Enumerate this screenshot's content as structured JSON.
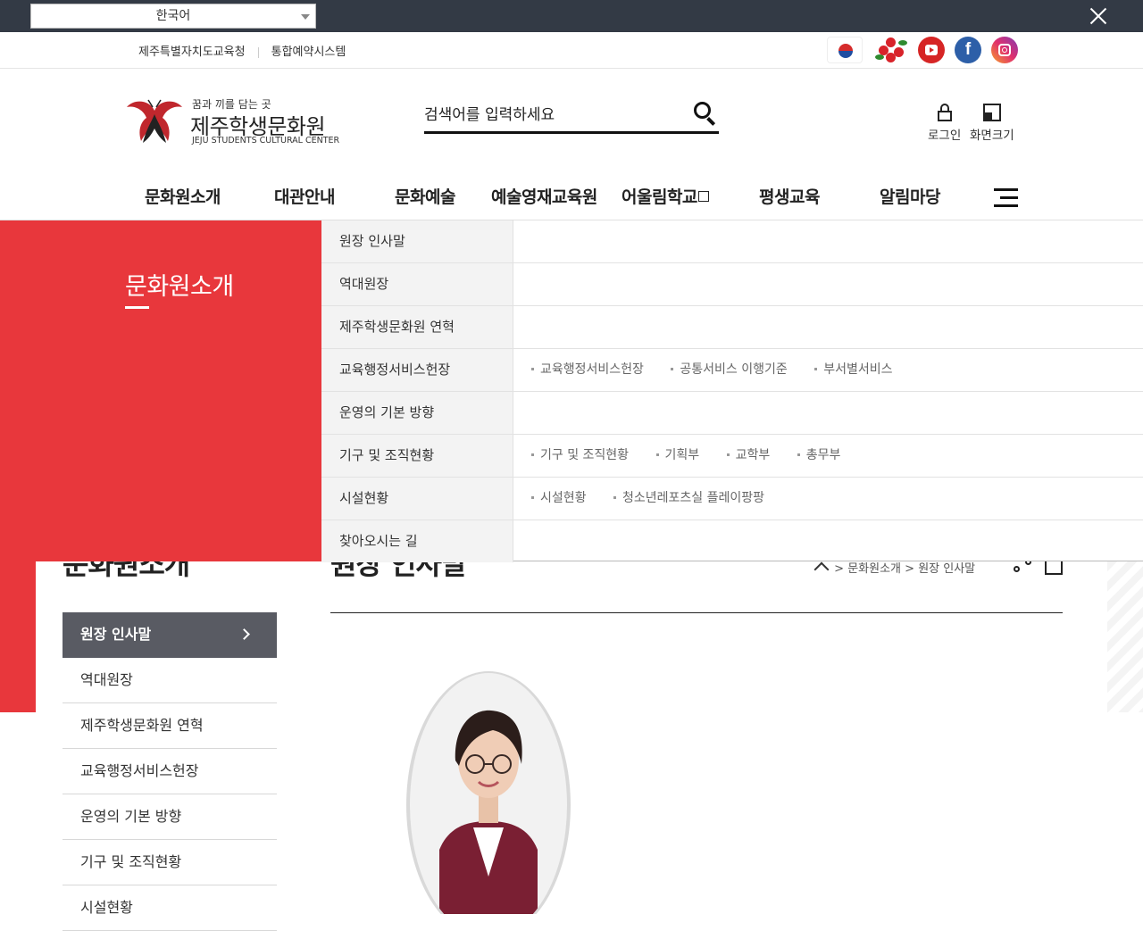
{
  "language_bar": {
    "selected": "한국어"
  },
  "util_links": [
    "제주특별자치도교육청",
    "통합예약시스템"
  ],
  "sns_icons": [
    "korea-flag-icon",
    "camellia-icon",
    "youtube-icon",
    "facebook-icon",
    "instagram-icon"
  ],
  "logo": {
    "tagline": "꿈과 끼를 담는 곳",
    "name": "제주학생문화원",
    "english": "JEJU STUDENTS CULTURAL CENTER"
  },
  "search": {
    "placeholder": "검색어를 입력하세요"
  },
  "header_buttons": {
    "login": "로그인",
    "zoom": "화면크기"
  },
  "gnb": [
    "문화원소개",
    "대관안내",
    "문화예술",
    "예술영재교육원",
    "어울림학교",
    "평생교육",
    "알림마당"
  ],
  "mega_menu": {
    "title": "문화원소개",
    "rows": [
      {
        "label": "원장 인사말",
        "subs": []
      },
      {
        "label": "역대원장",
        "subs": []
      },
      {
        "label": "제주학생문화원 연혁",
        "subs": []
      },
      {
        "label": "교육행정서비스헌장",
        "subs": [
          "교육행정서비스헌장",
          "공통서비스 이행기준",
          "부서별서비스"
        ]
      },
      {
        "label": "운영의 기본 방향",
        "subs": []
      },
      {
        "label": "기구 및 조직현황",
        "subs": [
          "기구 및 조직현황",
          "기획부",
          "교학부",
          "총무부"
        ]
      },
      {
        "label": "시설현황",
        "subs": [
          "시설현황",
          "청소년레포츠실 플레이팡팡"
        ]
      },
      {
        "label": "찾아오시는 길",
        "subs": []
      }
    ]
  },
  "content": {
    "side_title": "문화원소개",
    "page_title": "원장 인사말",
    "breadcrumb": {
      "sep": ">",
      "level1": "문화원소개",
      "level2": "원장 인사말"
    }
  },
  "lnb": [
    "원장 인사말",
    "역대원장",
    "제주학생문화원 연혁",
    "교육행정서비스헌장",
    "운영의 기본 방향",
    "기구 및 조직현황",
    "시설현황"
  ],
  "colors": {
    "accent_red": "#e8373c",
    "lnb_active": "#595b63",
    "lang_bar": "#333a45"
  }
}
